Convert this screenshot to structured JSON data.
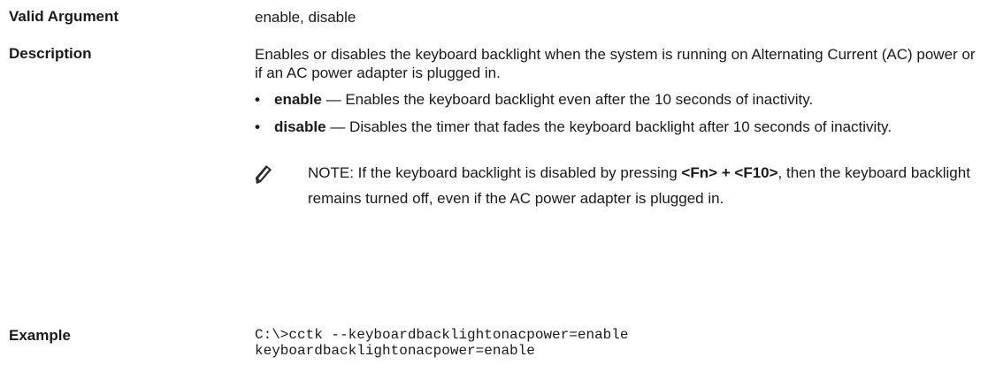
{
  "valid_argument": {
    "label": "Valid Argument",
    "value": "enable, disable"
  },
  "description": {
    "label": "Description",
    "text": "Enables or disables the keyboard backlight when the system is running on Alternating Current (AC) power or if an AC power adapter is plugged in.",
    "bullets": [
      {
        "term": "enable",
        "dash": " — ",
        "text": "Enables the keyboard backlight even after the 10 seconds of inactivity."
      },
      {
        "term": "disable",
        "dash": " — ",
        "text": "Disables the timer that fades the keyboard backlight after 10 seconds of inactivity."
      }
    ],
    "note": {
      "icon": "pencil-note-icon",
      "prefix": "NOTE:",
      "text_1": " If the keyboard backlight is disabled by pressing ",
      "key": "<Fn> + <F10>",
      "text_2": ", then the keyboard backlight remains turned off, even if the AC power adapter is plugged in."
    }
  },
  "example": {
    "label": "Example",
    "command": "C:\\>cctk --keyboardbacklightonacpower=enable",
    "output": "keyboardbacklightonacpower=enable"
  }
}
